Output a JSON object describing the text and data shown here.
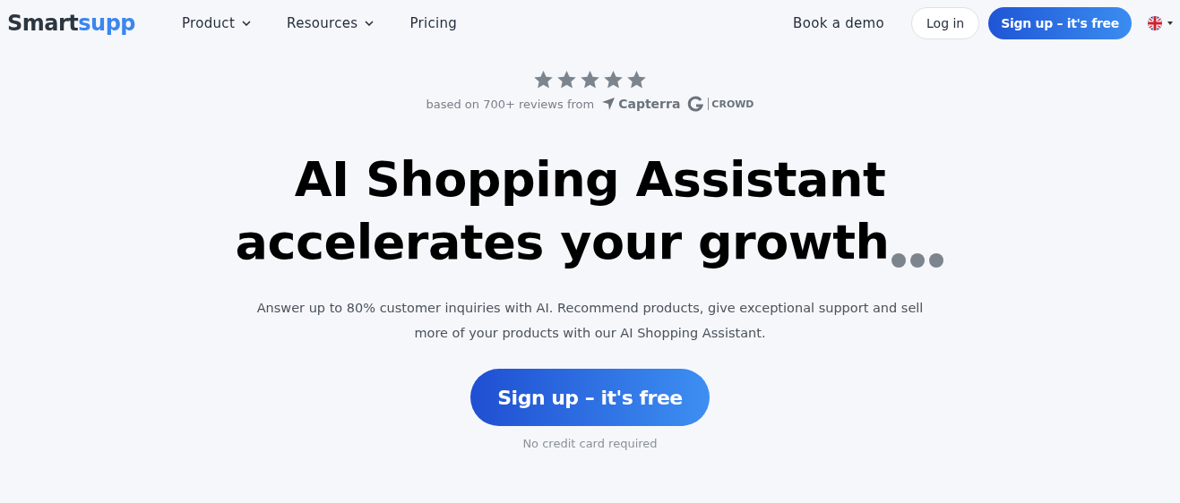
{
  "nav": {
    "logo": {
      "first": "Smart",
      "second": "supp"
    },
    "menu": [
      {
        "label": "Product",
        "dropdown": true
      },
      {
        "label": "Resources",
        "dropdown": true
      },
      {
        "label": "Pricing",
        "dropdown": false
      }
    ],
    "demo": "Book a demo",
    "login": "Log in",
    "signup": "Sign up – it's free"
  },
  "rating": {
    "stars": 5,
    "text": "based on 700+ reviews from",
    "capterra": "Capterra",
    "g2": "CROWD"
  },
  "hero": {
    "lines": [
      "AI Shopping Assistant",
      "accelerates your growth"
    ],
    "subtitle": "Answer up to 80% customer inquiries with AI. Recommend products, give exceptional support and sell more of your products with our AI Shopping Assistant.",
    "cta": "Sign up – it's free",
    "note": "No credit card required"
  }
}
